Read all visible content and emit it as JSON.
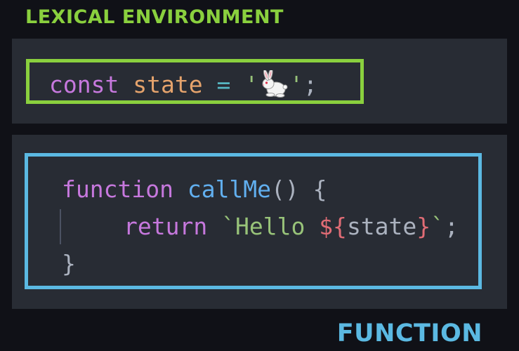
{
  "titles": {
    "lexical": "LEXICAL ENVIRONMENT",
    "function": "FUNCTION"
  },
  "colors": {
    "lexical_accent": "#8ad03e",
    "function_accent": "#5bb9e2",
    "background": "#101117",
    "panel": "#282c34",
    "keyword": "#c678dd",
    "variable": "#e5a36c",
    "operator": "#56b6c2",
    "function_name": "#61afef",
    "punctuation": "#abb2bf",
    "string": "#98c379",
    "template_interp": "#e06c75"
  },
  "lexical_code": {
    "keyword": "const",
    "variable": "state",
    "operator": "=",
    "quote_open": "'",
    "emoji_icon": "rabbit-emoji",
    "quote_close": "'",
    "semicolon": ";"
  },
  "function_code": {
    "line1": {
      "keyword": "function",
      "name": "callMe",
      "parens": "()",
      "brace_open": "{"
    },
    "line2": {
      "keyword": "return",
      "backtick_open": "`",
      "text": "Hello",
      "interp_open": "${",
      "variable": "state",
      "interp_close": "}",
      "backtick_close": "`",
      "semicolon": ";"
    },
    "line3": {
      "brace_close": "}"
    }
  }
}
